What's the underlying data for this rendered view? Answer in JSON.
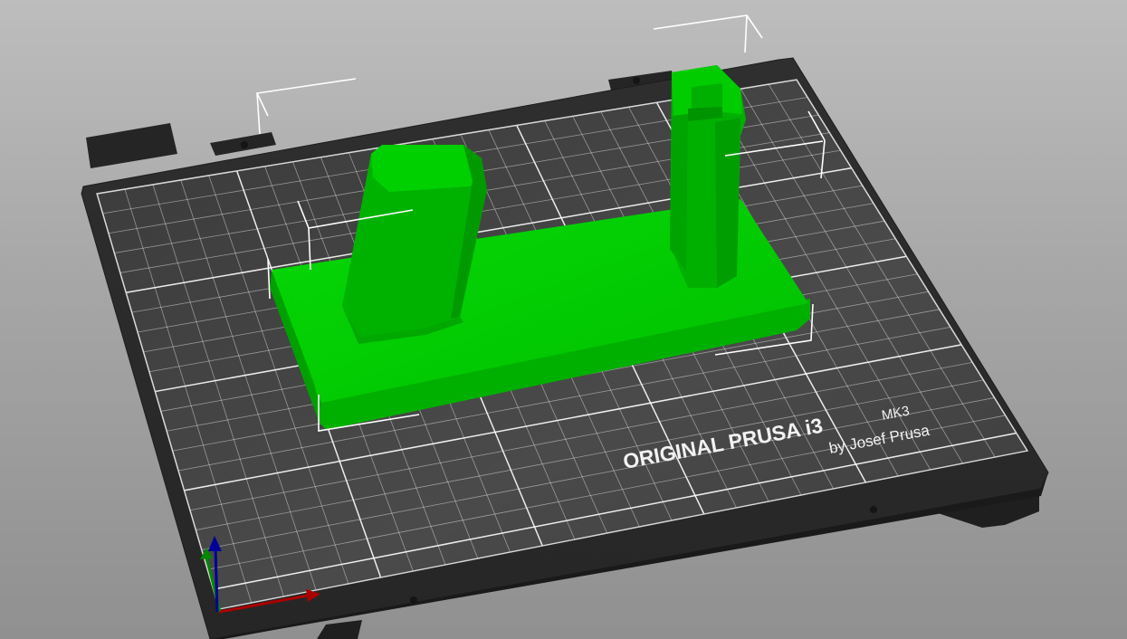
{
  "app": {
    "view": "3D plater view"
  },
  "bed": {
    "brand_line1": "ORIGINAL PRUSA i3",
    "brand_model": "MK3",
    "brand_line2": "by Josef Prusa",
    "plate_color": "#2b2b2b",
    "grid_color": "#ffffff"
  },
  "object": {
    "color": "#00c800",
    "selected": true
  },
  "axes": {
    "x_color": "#b00000",
    "y_color": "#00a000",
    "z_color": "#0000b0"
  }
}
